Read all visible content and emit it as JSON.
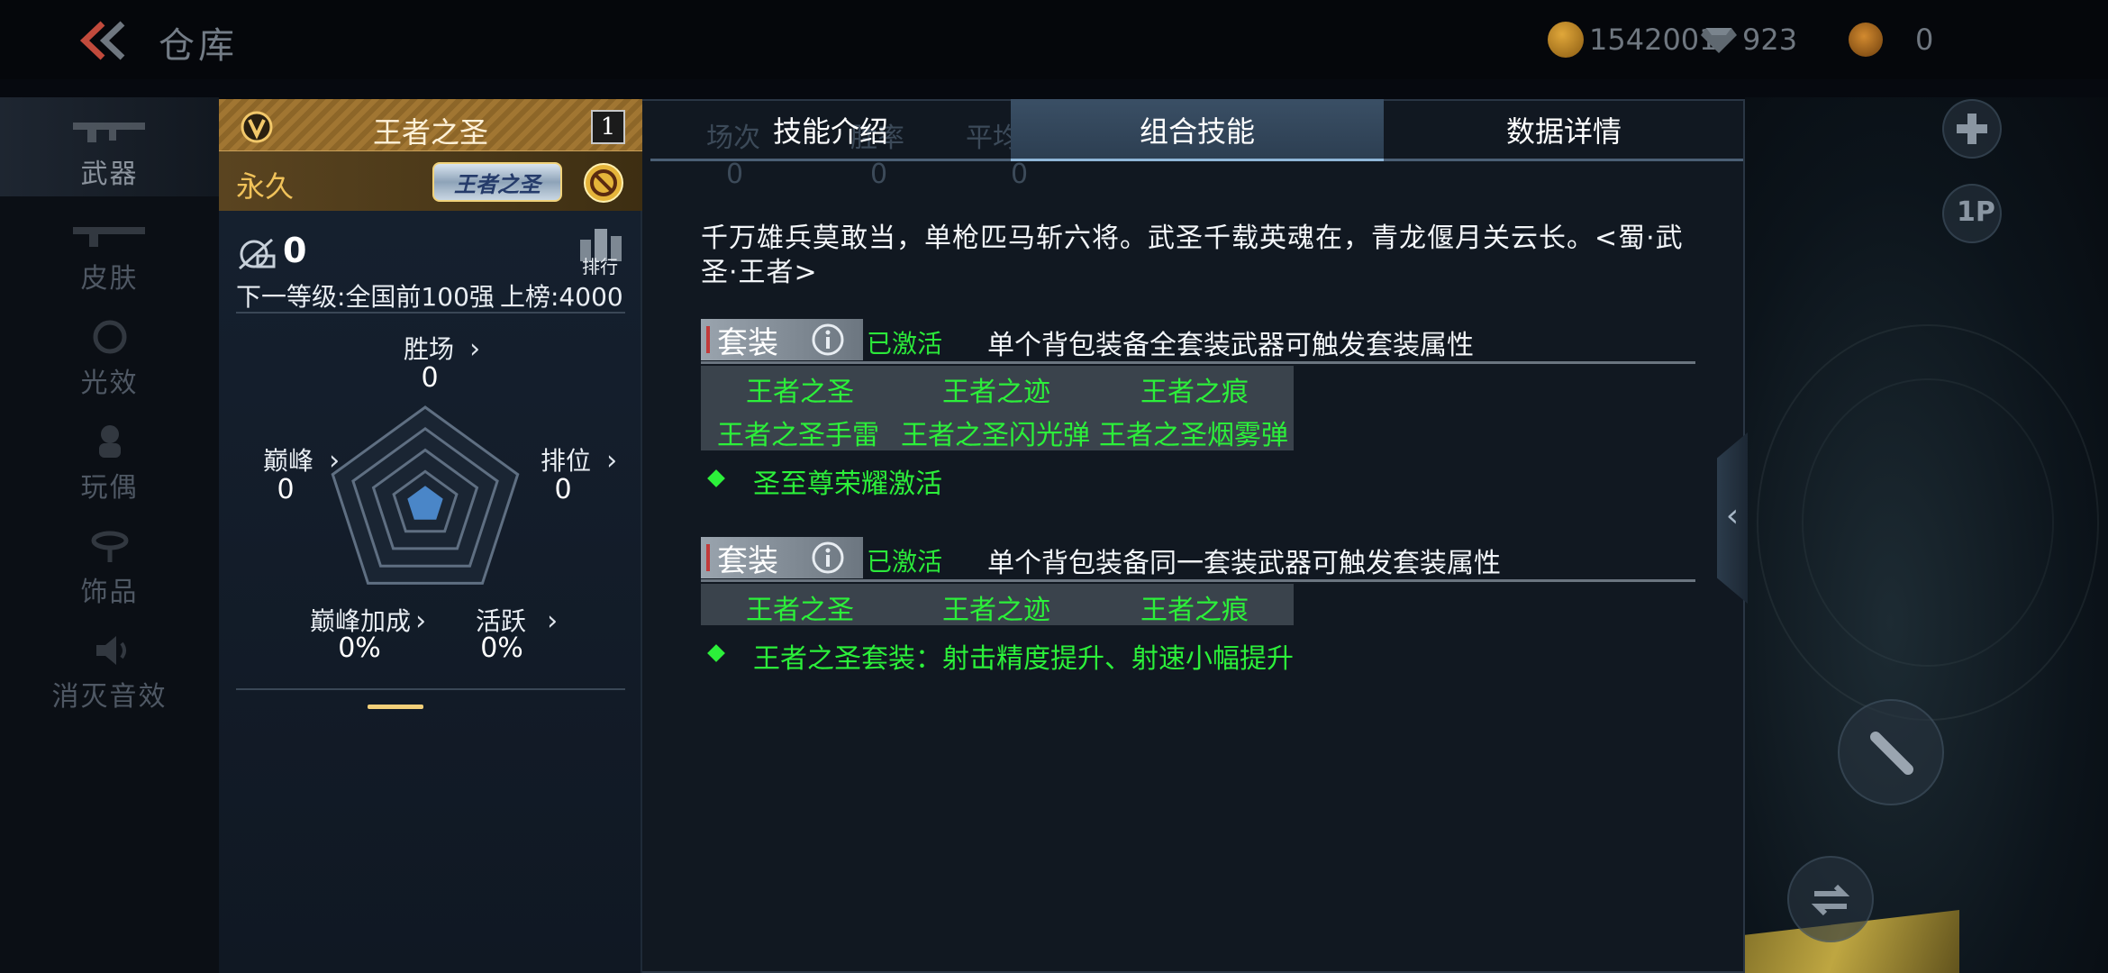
{
  "topbar": {
    "title": "仓库",
    "coins": "1542001",
    "gems": "923",
    "tokens": "0"
  },
  "leftnav": {
    "items": [
      {
        "label": "武器",
        "active": true
      },
      {
        "label": "皮肤",
        "active": false
      },
      {
        "label": "光效",
        "active": false
      },
      {
        "label": "玩偶",
        "active": false
      },
      {
        "label": "饰品",
        "active": false
      },
      {
        "label": "消灭音效",
        "active": false
      }
    ]
  },
  "card": {
    "name": "王者之圣",
    "count": "1",
    "duration": "永久",
    "badge_text": "王者之圣",
    "kills": "0",
    "rank_label": "排行",
    "next_level": "下一等级:全国前100强",
    "on_board": "上榜:4000",
    "stats": {
      "wins": {
        "label": "胜场",
        "value": "0"
      },
      "peak": {
        "label": "巅峰",
        "value": "0"
      },
      "ranked": {
        "label": "排位",
        "value": "0"
      },
      "peak_bonus": {
        "label": "巅峰加成",
        "value": "0%"
      },
      "active": {
        "label": "活跃",
        "value": "0%"
      }
    },
    "radar_fill": 0.12
  },
  "tabs": {
    "items": [
      {
        "label": "技能介绍",
        "active": false
      },
      {
        "label": "组合技能",
        "active": true
      },
      {
        "label": "数据详情",
        "active": false
      }
    ],
    "ghost_labels": [
      "场次",
      "胜率",
      "平均KD"
    ],
    "ghost_values": [
      "0",
      "0",
      "0"
    ]
  },
  "content": {
    "description": "千万雄兵莫敢当，单枪匹马斩六将。武圣千载英魂在，青龙偃月关云长。<蜀·武圣·王者>",
    "sets": [
      {
        "tag": "套装",
        "status": "已激活",
        "rule": "单个背包装备全套装武器可触发套装属性",
        "items": [
          "王者之圣",
          "王者之迹",
          "王者之痕",
          "王者之圣手雷",
          "王者之圣闪光弹",
          "王者之圣烟雾弹"
        ],
        "bonus": "圣至尊荣耀激活"
      },
      {
        "tag": "套装",
        "status": "已激活",
        "rule": "单个背包装备同一套装武器可触发套装属性",
        "items": [
          "王者之圣",
          "王者之迹",
          "王者之痕"
        ],
        "bonus": "王者之圣套装：射击精度提升、射速小幅提升"
      }
    ]
  },
  "right_controls": {
    "p1_label": "1P"
  },
  "colors": {
    "green": "#2cf03a",
    "gold": "#f0c25a",
    "tab_active": "#34495e"
  }
}
